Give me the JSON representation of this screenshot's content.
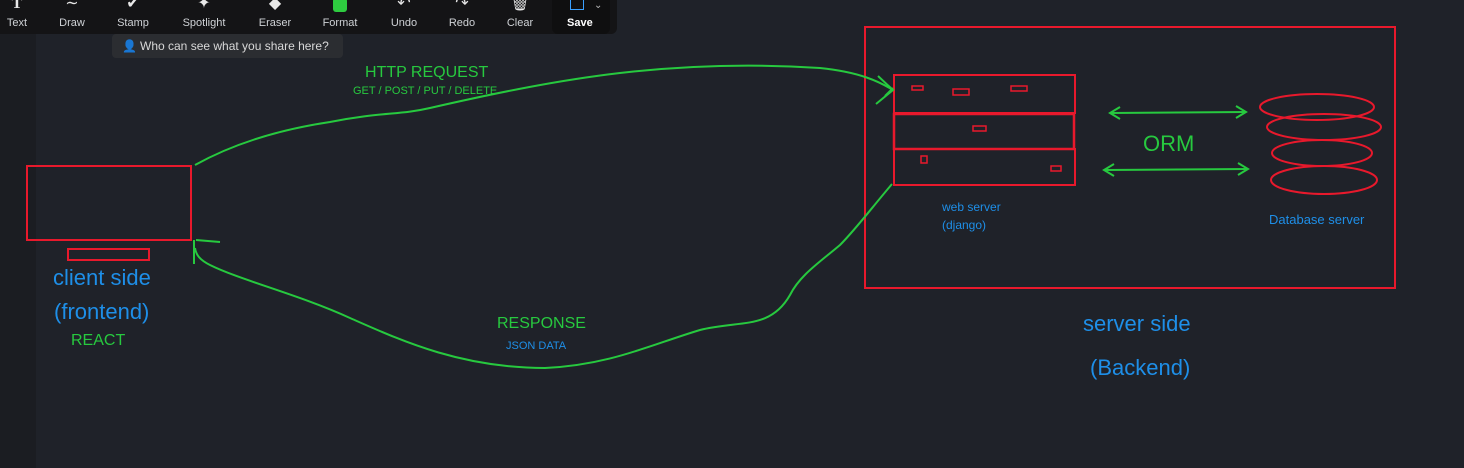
{
  "toolbar": {
    "tools": [
      {
        "label": "Text",
        "icon": "text-icon"
      },
      {
        "label": "Draw",
        "icon": "draw-icon"
      },
      {
        "label": "Stamp",
        "icon": "stamp-icon"
      },
      {
        "label": "Spotlight",
        "icon": "spotlight-icon"
      },
      {
        "label": "Eraser",
        "icon": "eraser-icon"
      },
      {
        "label": "Format",
        "icon": "format-icon"
      },
      {
        "label": "Undo",
        "icon": "undo-icon"
      },
      {
        "label": "Redo",
        "icon": "redo-icon"
      },
      {
        "label": "Clear",
        "icon": "trash-icon"
      }
    ],
    "save_label": "Save",
    "format_color": "#2ecc40"
  },
  "tooltip": {
    "text": "Who can see what you share here?"
  },
  "diagram": {
    "http_request": "HTTP REQUEST",
    "http_methods": "GET / POST / PUT / DELETE",
    "response": "RESPONSE",
    "response_data": "JSON DATA",
    "client_side": "client side",
    "frontend": "(frontend)",
    "react": "REACT",
    "web_server": "web server",
    "django": "(django)",
    "orm": "ORM",
    "database_server": "Database server",
    "server_side": "server side",
    "backend": "(Backend)"
  },
  "colors": {
    "red": "#e8192c",
    "green": "#27c93f",
    "blue": "#1e8fe8",
    "background": "#1f2229"
  }
}
